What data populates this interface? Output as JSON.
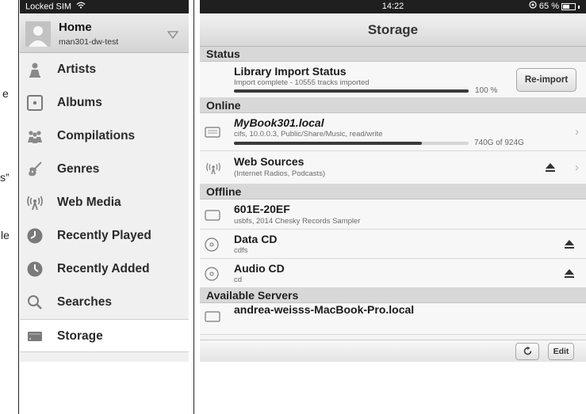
{
  "background": {
    "fragments": [
      "e",
      "s”",
      "le"
    ]
  },
  "sidebar": {
    "status_text": "Locked SIM",
    "home": {
      "title": "Home",
      "subtitle": "man301-dw-test"
    },
    "items": [
      {
        "label": "Artists",
        "icon": "artist-icon"
      },
      {
        "label": "Albums",
        "icon": "album-icon"
      },
      {
        "label": "Compilations",
        "icon": "compilations-icon"
      },
      {
        "label": "Genres",
        "icon": "guitar-icon"
      },
      {
        "label": "Web Media",
        "icon": "broadcast-icon"
      },
      {
        "label": "Recently Played",
        "icon": "clock-icon"
      },
      {
        "label": "Recently Added",
        "icon": "clock-icon"
      },
      {
        "label": "Searches",
        "icon": "search-icon"
      },
      {
        "label": "Storage",
        "icon": "storage-icon",
        "active": true
      }
    ]
  },
  "storage": {
    "status_time": "14:22",
    "battery_text": "65 %",
    "battery_level": 0.65,
    "title": "Storage",
    "sections": {
      "status": "Status",
      "online": "Online",
      "offline": "Offline",
      "available": "Available Servers"
    },
    "library": {
      "title": "Library Import Status",
      "subtitle": "Import complete - 10555 tracks imported",
      "progress_text": "100 %",
      "progress": 1.0,
      "button": "Re-import"
    },
    "mybook": {
      "title": "MyBook301.local",
      "subtitle": "cifs, 10.0.0.3, Public/Share/Music, read/write",
      "usage_text": "740G of 924G",
      "usage": 0.8
    },
    "websources": {
      "title": "Web Sources",
      "subtitle": "(Internet Radios, Podcasts)"
    },
    "offline_items": [
      {
        "title": "601E-20EF",
        "subtitle": "usbfs, 2014 Chesky Records Sampler"
      },
      {
        "title": "Data CD",
        "subtitle": "cdfs"
      },
      {
        "title": "Audio CD",
        "subtitle": "cd"
      }
    ],
    "server": {
      "title": "andrea-weisss-MacBook-Pro.local"
    },
    "toolbar": {
      "edit": "Edit"
    }
  }
}
